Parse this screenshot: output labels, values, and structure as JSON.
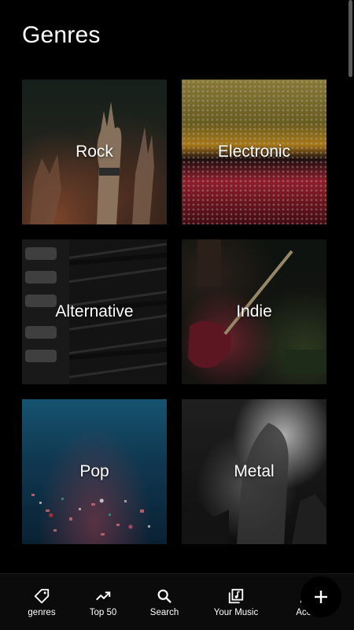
{
  "page": {
    "title": "Genres"
  },
  "genres": [
    {
      "label": "Rock"
    },
    {
      "label": "Electronic"
    },
    {
      "label": "Alternative"
    },
    {
      "label": "Indie"
    },
    {
      "label": "Pop"
    },
    {
      "label": "Metal"
    }
  ],
  "nav": {
    "items": [
      {
        "label": "genres",
        "icon": "tag-icon"
      },
      {
        "label": "Top 50",
        "icon": "trending-up-icon"
      },
      {
        "label": "Search",
        "icon": "search-icon"
      },
      {
        "label": "Your Music",
        "icon": "library-music-icon"
      },
      {
        "label": "Acco",
        "icon": "person-icon"
      }
    ],
    "fab_icon": "plus-icon"
  },
  "colors": {
    "background": "#000000",
    "nav_background": "#0b0b0b",
    "text": "#ffffff"
  }
}
